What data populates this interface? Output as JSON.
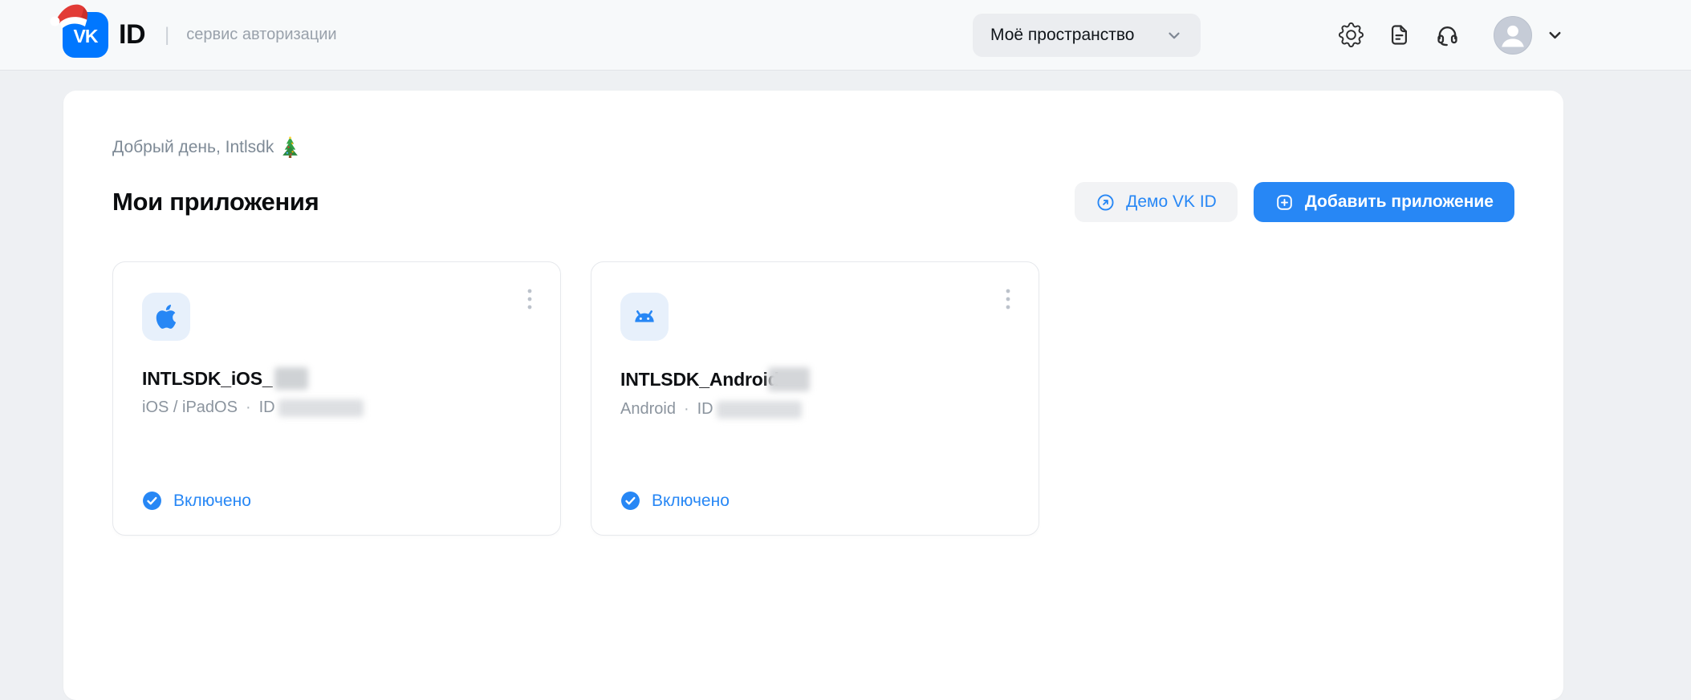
{
  "header": {
    "logo": {
      "vk_monogram": "VK",
      "product": "ID",
      "separator": "|",
      "tagline": "сервис авторизации"
    },
    "space_dropdown": {
      "value": "Моё пространство"
    },
    "icons": {
      "settings": "gear-icon",
      "documentation": "document-icon",
      "support": "headset-icon",
      "account": "avatar-with-chevron"
    }
  },
  "main": {
    "greeting": "Добрый день, Intlsdk",
    "greeting_icon": "christmas-tree",
    "section_title": "Мои приложения",
    "buttons": {
      "demo": "Демо VK ID",
      "add": "Добавить приложение"
    },
    "apps": [
      {
        "platform_icon": "apple",
        "name": "INTLSDK_iOS_",
        "name_redacted": true,
        "platform": "iOS / iPadOS",
        "separator": "·",
        "id_label": "ID",
        "id_redacted": true,
        "status": "Включено"
      },
      {
        "platform_icon": "android",
        "name": "INTLSDK_Android",
        "name_redacted": true,
        "platform": "Android",
        "separator": "·",
        "id_label": "ID",
        "id_redacted": true,
        "status": "Включено"
      }
    ]
  },
  "colors": {
    "vk_blue": "#0077FF",
    "accent_blue": "#2787F5",
    "page_bg": "#eef0f3",
    "header_bg": "#f7f9fa",
    "icon_tile_bg": "#e7f0fb"
  }
}
